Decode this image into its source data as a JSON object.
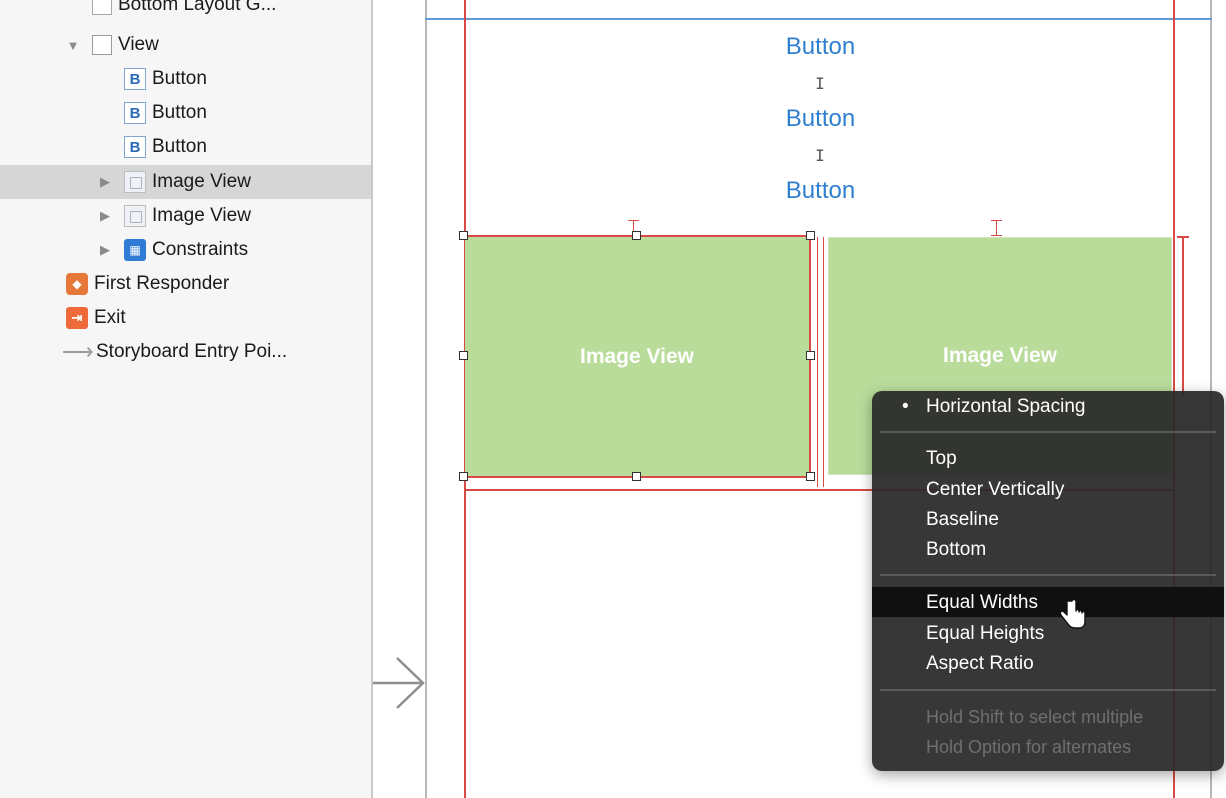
{
  "outline": {
    "items": [
      {
        "label": "Bottom Layout G...",
        "icon": "layout-guide-icon"
      },
      {
        "label": "View",
        "icon": "view-icon",
        "expanded": true
      },
      {
        "label": "Button",
        "icon": "button-icon",
        "glyph": "B"
      },
      {
        "label": "Button",
        "icon": "button-icon",
        "glyph": "B"
      },
      {
        "label": "Button",
        "icon": "button-icon",
        "glyph": "B"
      },
      {
        "label": "Image View",
        "icon": "image-view-icon",
        "selected": true
      },
      {
        "label": "Image View",
        "icon": "image-view-icon"
      },
      {
        "label": "Constraints",
        "icon": "constraints-icon"
      },
      {
        "label": "First Responder",
        "icon": "first-responder-icon"
      },
      {
        "label": "Exit",
        "icon": "exit-icon"
      },
      {
        "label": "Storyboard Entry Poi...",
        "icon": "arrow-right-icon"
      }
    ]
  },
  "canvas": {
    "buttons": [
      "Button",
      "Button",
      "Button"
    ],
    "image_views": [
      "Image View",
      "Image View"
    ],
    "colors": {
      "constraint_red": "#d84a45",
      "image_view_green": "#b9dc9b",
      "button_blue": "#2f7fcf"
    }
  },
  "menu": {
    "checked_item": "Horizontal Spacing",
    "group1": [
      "Top",
      "Center Vertically",
      "Baseline",
      "Bottom"
    ],
    "group2": [
      "Equal Widths",
      "Equal Heights",
      "Aspect Ratio"
    ],
    "highlighted_item": "Equal Widths",
    "hints": [
      "Hold Shift to select multiple",
      "Hold Option for alternates"
    ]
  }
}
